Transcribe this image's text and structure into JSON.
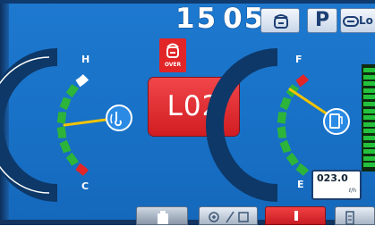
{
  "header": {
    "clock_hours": "15",
    "clock_minutes": "05",
    "park_label": "P",
    "mode_fragment": "Lo"
  },
  "alert": {
    "icon_label": "OVER",
    "code": "L02"
  },
  "coolant_gauge": {
    "high_label": "H",
    "low_label": "C",
    "level": 0.42,
    "icon": "coolant-temperature-icon"
  },
  "fuel_gauge": {
    "full_label": "F",
    "empty_label": "E",
    "level": 0.62,
    "icon": "fuel-icon"
  },
  "hour_meter": {
    "value": "023.0",
    "unit": "ℓ/h"
  },
  "colors": {
    "background": "#1871c6",
    "alert_red": "#e22527",
    "needle": "#f2c300",
    "green_segment": "#2db43a"
  }
}
